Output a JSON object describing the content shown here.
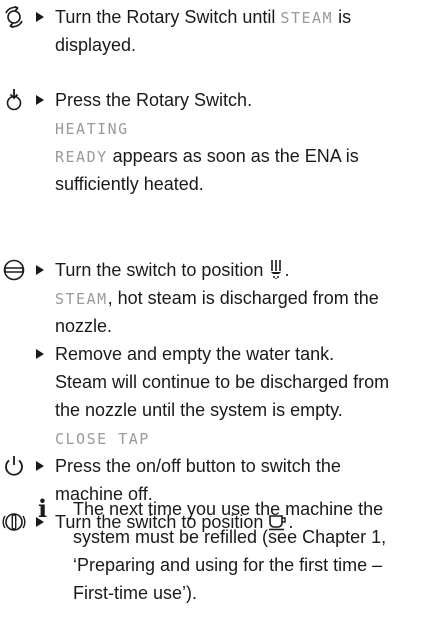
{
  "steps": [
    {
      "icon": "rotary-turn-icon",
      "lines": [
        {
          "parts": [
            {
              "t": "text",
              "v": "Turn the Rotary Switch until "
            },
            {
              "t": "disp",
              "v": "STEAM"
            },
            {
              "t": "text",
              "v": " is"
            }
          ]
        },
        {
          "parts": [
            {
              "t": "text",
              "v": "displayed."
            }
          ]
        }
      ]
    },
    {
      "icon": "rotary-press-icon",
      "lines": [
        {
          "parts": [
            {
              "t": "text",
              "v": "Press the Rotary Switch."
            }
          ]
        },
        {
          "parts": [
            {
              "t": "disp",
              "v": "HEATING"
            }
          ]
        },
        {
          "parts": [
            {
              "t": "disp",
              "v": "READY"
            },
            {
              "t": "text",
              "v": " appears as soon as the ENA is"
            }
          ]
        },
        {
          "parts": [
            {
              "t": "text",
              "v": "sufficiently heated."
            }
          ]
        }
      ]
    },
    {
      "icon": "switch-position-icon",
      "lines": [
        {
          "parts": [
            {
              "t": "text",
              "v": "Turn the switch to position "
            },
            {
              "t": "sym",
              "v": "steam-symbol-icon"
            },
            {
              "t": "text",
              "v": "."
            }
          ]
        },
        {
          "parts": [
            {
              "t": "disp",
              "v": "STEAM"
            },
            {
              "t": "text",
              "v": ", hot steam is discharged from the"
            }
          ]
        },
        {
          "parts": [
            {
              "t": "text",
              "v": "nozzle."
            }
          ]
        }
      ]
    },
    {
      "icon": "",
      "lines": [
        {
          "parts": [
            {
              "t": "text",
              "v": "Remove and empty the water tank."
            }
          ]
        },
        {
          "parts": [
            {
              "t": "text",
              "v": "Steam will continue to be discharged from"
            }
          ]
        },
        {
          "parts": [
            {
              "t": "text",
              "v": "the nozzle until the system is empty."
            }
          ]
        },
        {
          "parts": [
            {
              "t": "disp",
              "v": "CLOSE TAP"
            }
          ]
        }
      ]
    },
    {
      "icon": "power-icon",
      "lines": [
        {
          "parts": [
            {
              "t": "text",
              "v": "Press the on/off button to switch the"
            }
          ]
        },
        {
          "parts": [
            {
              "t": "text",
              "v": "machine off."
            }
          ]
        }
      ]
    },
    {
      "icon": "rotary-power-icon",
      "lines": [
        {
          "parts": [
            {
              "t": "text",
              "v": "Turn the switch to position "
            },
            {
              "t": "sym",
              "v": "cup-symbol-icon"
            },
            {
              "t": "text",
              "v": "."
            }
          ]
        }
      ]
    }
  ],
  "info": {
    "icon": "info-icon",
    "glyph": "i",
    "lines": [
      "The next time you use the machine the",
      "system must be refilled (see Chapter 1,",
      "‘Preparing and using for the first time –",
      "First-time use’)."
    ]
  }
}
